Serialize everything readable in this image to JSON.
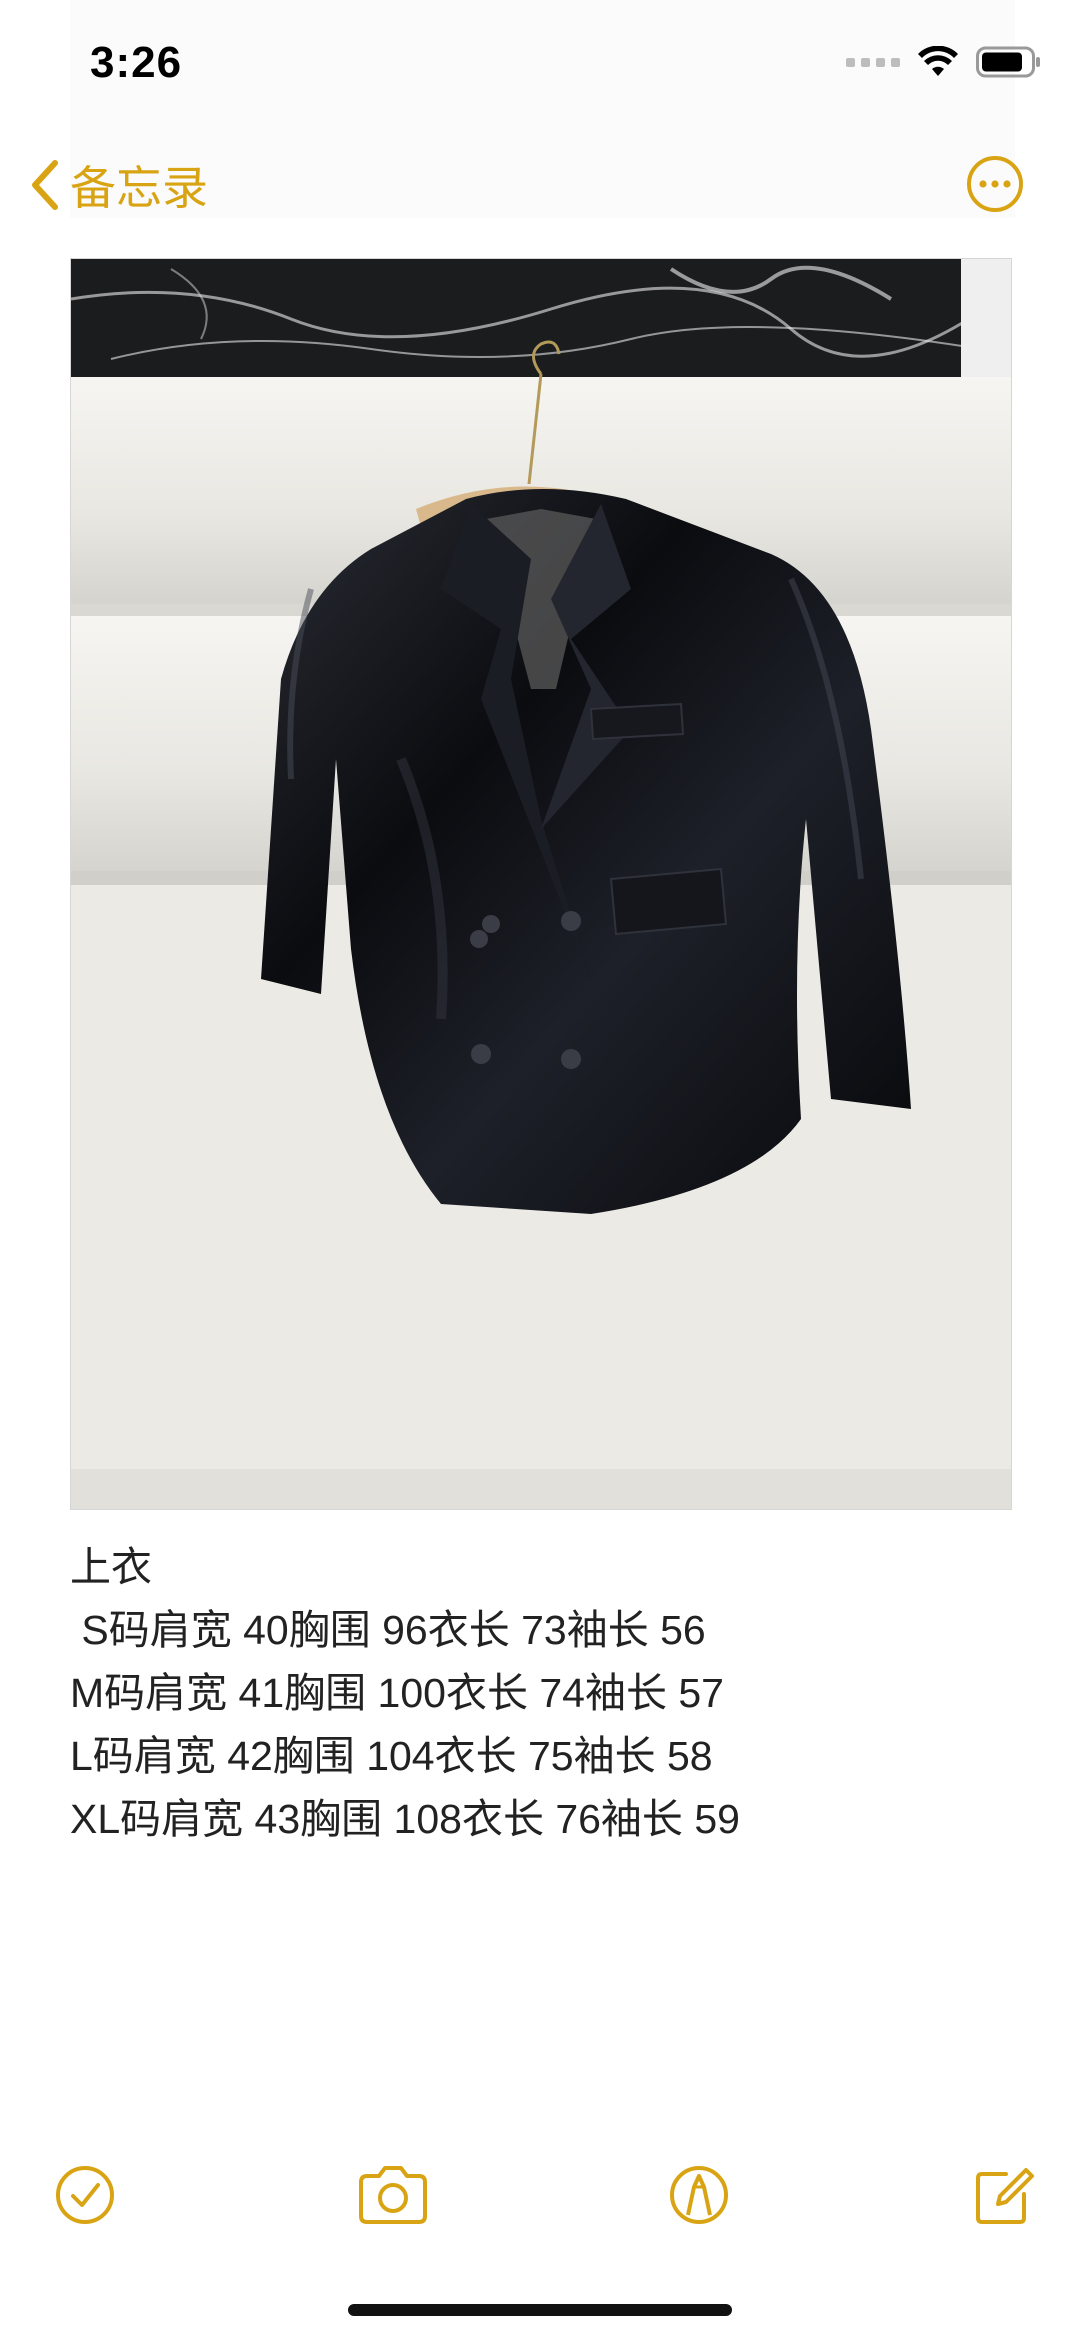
{
  "status_bar": {
    "time": "3:26",
    "battery_level": 0.75
  },
  "nav": {
    "back_label": "备忘录",
    "back_icon": "chevron-left-icon",
    "more_icon": "ellipsis-circle-icon",
    "accent_color": "#d9a414"
  },
  "photo": {
    "subject": "black satin double-breasted blazer on hanger"
  },
  "note": {
    "lines": [
      "上衣",
      " S码肩宽 40胸围 96衣长 73袖长 56",
      "M码肩宽 41胸围 100衣长 74袖长 57",
      "L码肩宽 42胸围 104衣长 75袖长 58",
      "XL码肩宽 43胸围 108衣长 76袖长 59"
    ]
  },
  "toolbar": {
    "icons": [
      "checklist-icon",
      "camera-icon",
      "markup-icon",
      "compose-icon"
    ]
  }
}
